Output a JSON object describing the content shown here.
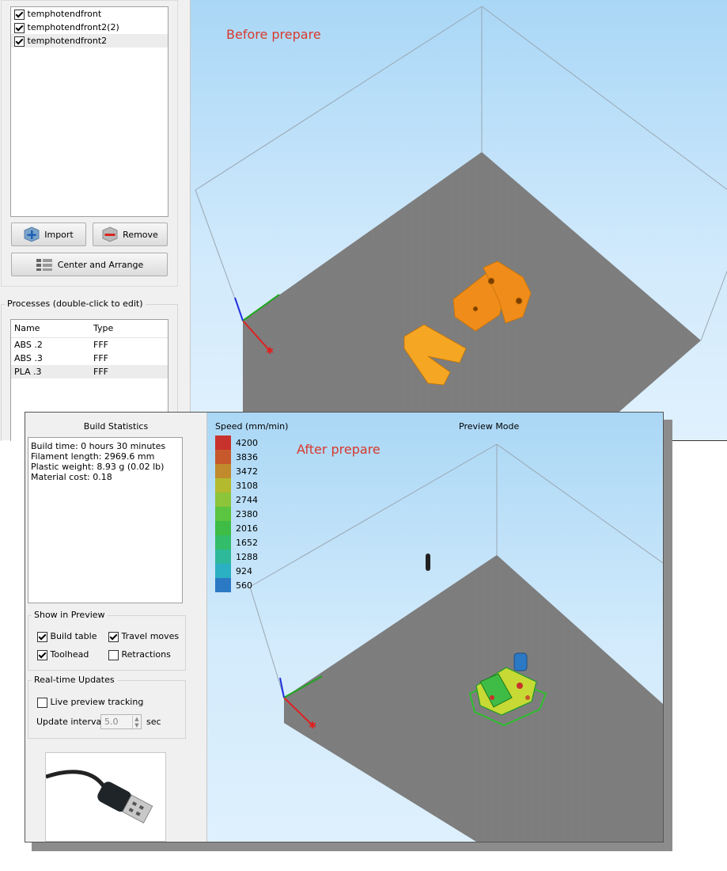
{
  "top": {
    "annotation": "Before prepare",
    "models": [
      {
        "name": "temphotendfront",
        "checked": true
      },
      {
        "name": "temphotendfront2(2)",
        "checked": true
      },
      {
        "name": "temphotendfront2",
        "checked": true
      }
    ],
    "import_label": "Import",
    "remove_label": "Remove",
    "arrange_label": "Center and Arrange",
    "processes_title": "Processes (double-click to edit)",
    "process_columns": [
      "Name",
      "Type"
    ],
    "processes": [
      {
        "name": "ABS .2",
        "type": "FFF"
      },
      {
        "name": "ABS .3",
        "type": "FFF"
      },
      {
        "name": "PLA .3",
        "type": "FFF"
      }
    ]
  },
  "bottom": {
    "annotation": "After prepare",
    "build_stats_title": "Build Statistics",
    "stats": [
      "Build time: 0 hours 30 minutes",
      "Filament length: 2969.6 mm",
      "Plastic weight: 8.93 g (0.02 lb)",
      "Material cost: 0.18"
    ],
    "show_in_preview": {
      "title": "Show in Preview",
      "build_table": {
        "label": "Build table",
        "checked": true
      },
      "travel_moves": {
        "label": "Travel moves",
        "checked": true
      },
      "toolhead": {
        "label": "Toolhead",
        "checked": true
      },
      "retractions": {
        "label": "Retractions",
        "checked": false
      }
    },
    "realtime": {
      "title": "Real-time Updates",
      "live_label": "Live preview tracking",
      "live_checked": false,
      "interval_label": "Update interval",
      "interval_value": "5.0",
      "interval_unit": "sec"
    },
    "preview_mode": "Preview Mode",
    "speed_title": "Speed (mm/min)",
    "speed_legend": [
      {
        "value": "4200",
        "color": "#c8322c"
      },
      {
        "value": "3836",
        "color": "#c6592b"
      },
      {
        "value": "3472",
        "color": "#c08a2d"
      },
      {
        "value": "3108",
        "color": "#b3ba2e"
      },
      {
        "value": "2744",
        "color": "#8cc43a"
      },
      {
        "value": "2380",
        "color": "#5bc440"
      },
      {
        "value": "2016",
        "color": "#3fbc45"
      },
      {
        "value": "1652",
        "color": "#33bc6a"
      },
      {
        "value": "1288",
        "color": "#2eb99a"
      },
      {
        "value": "924",
        "color": "#2ab0c2"
      },
      {
        "value": "560",
        "color": "#2b79c4"
      }
    ]
  },
  "colors": {
    "sky_top": "#a9d7f6",
    "bed": "#7d7d7d",
    "part_orange": "#f39a1e",
    "annotation_red": "#d8392b"
  }
}
